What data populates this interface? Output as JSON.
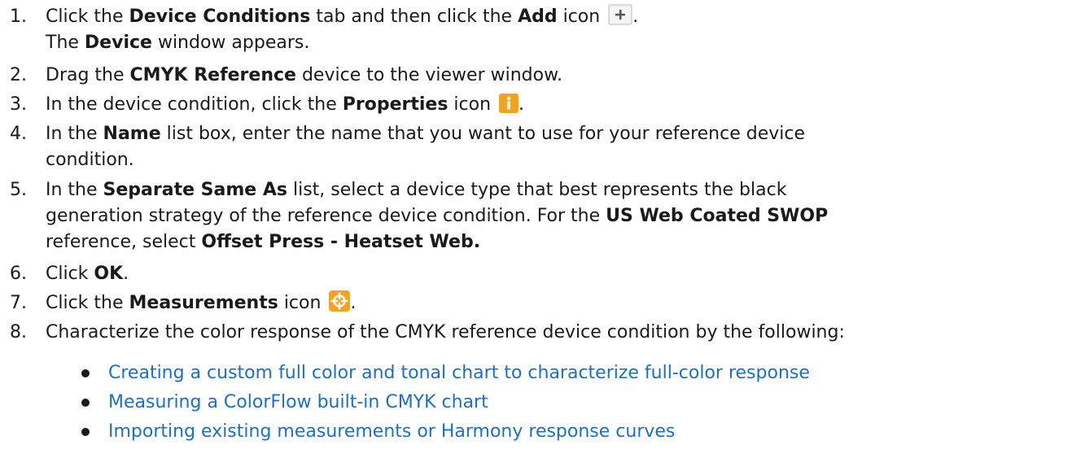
{
  "steps": [
    {
      "num": "1.",
      "l1_a": "Click the ",
      "l1_b": "Device Conditions",
      "l1_c": " tab and then click the ",
      "l1_d": "Add",
      "l1_e": " icon ",
      "l1_f": ".",
      "l2_a": "The ",
      "l2_b": "Device",
      "l2_c": " window appears.",
      "icon": "add-plus-icon"
    },
    {
      "num": "2.",
      "a": "Drag the ",
      "b": "CMYK Reference",
      "c": " device to the viewer window."
    },
    {
      "num": "3.",
      "a": "In the device condition, click the ",
      "b": "Properties",
      "c": " icon ",
      "d": ".",
      "icon": "info-icon"
    },
    {
      "num": "4.",
      "l1_a": "In the ",
      "l1_b": "Name",
      "l1_c": " list box, enter the name that you want to use for your reference device",
      "l2": "condition."
    },
    {
      "num": "5.",
      "l1_a": "In the ",
      "l1_b": "Separate Same As",
      "l1_c": " list, select a device type that best represents the black",
      "l2_a": "generation strategy of the reference device condition. For the ",
      "l2_b": "US Web Coated SWOP",
      "l3_a": "reference, select ",
      "l3_b": "Offset Press - Heatset Web."
    },
    {
      "num": "6.",
      "a": "Click ",
      "b": "OK",
      "c": "."
    },
    {
      "num": "7.",
      "a": "Click the ",
      "b": "Measurements",
      "c": " icon ",
      "d": ".",
      "icon": "crosshair-target-icon"
    },
    {
      "num": "8.",
      "a": "Characterize the color response of the CMYK reference device condition by the following:"
    }
  ],
  "links": [
    "Creating a custom full color and tonal chart to characterize full-color response",
    "Measuring a ColorFlow built-in CMYK chart",
    "Importing existing measurements or Harmony response curves"
  ],
  "colors": {
    "link": "#1b6fc8",
    "icon_orange": "#f7a21b",
    "text": "#1a1a1a"
  }
}
